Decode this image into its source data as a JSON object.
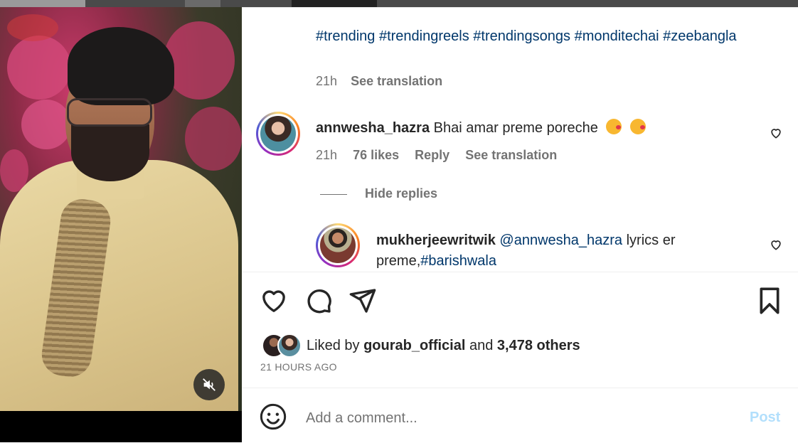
{
  "post": {
    "caption_tags": "#trending #trendingreels #trendingsongs #monditechai #zeebangla",
    "caption_time": "21h",
    "caption_see_translation": "See translation"
  },
  "comment": {
    "username": "annwesha_hazra",
    "text": "Bhai amar preme poreche",
    "time": "21h",
    "likes": "76 likes",
    "reply": "Reply",
    "see_translation": "See translation",
    "hide_replies": "Hide replies"
  },
  "reply": {
    "username": "mukherjeewritwik",
    "mention": "@annwesha_hazra",
    "text_middle": " lyrics er preme,",
    "hashtag": "#barishwala"
  },
  "likes": {
    "prefix": "Liked by ",
    "user": "gourab_official",
    "middle": " and ",
    "others": "3,478 others"
  },
  "timestamp": "21 HOURS AGO",
  "composer": {
    "placeholder": "Add a comment...",
    "post_label": "Post"
  },
  "colors": {
    "link": "#00376b",
    "muted": "#737373",
    "post_disabled": "#b2dffc"
  },
  "icons": [
    "heart-icon",
    "comment-icon",
    "share-icon",
    "bookmark-icon",
    "emoji-icon",
    "muted-icon"
  ]
}
